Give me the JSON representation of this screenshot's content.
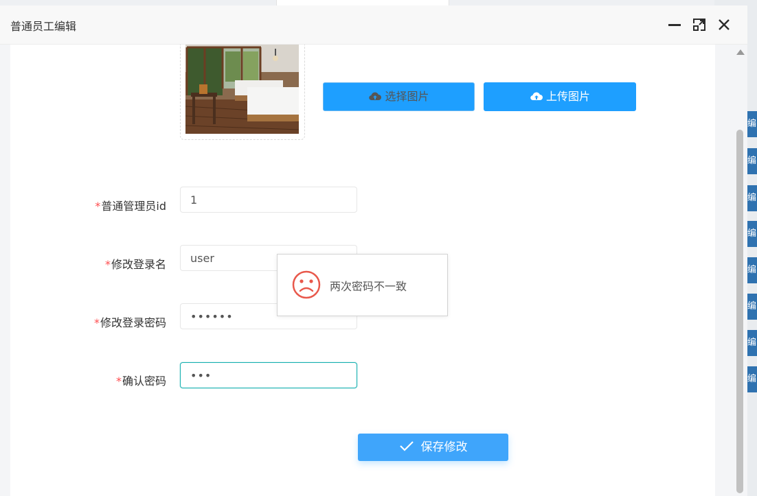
{
  "dialog": {
    "title": "普通员工编辑",
    "controls": {
      "minimize": "minimize-icon",
      "maximize": "maximize-icon",
      "close": "close-icon"
    }
  },
  "image": {
    "description_icon": "image-preview"
  },
  "buttons": {
    "select_image": "选择图片",
    "upload_image": "上传图片",
    "save": "保存修改"
  },
  "form": {
    "admin_id": {
      "label": "普通管理员id",
      "value": "1"
    },
    "login_name": {
      "label": "修改登录名",
      "value": "user"
    },
    "login_password": {
      "label": "修改登录密码",
      "value": "••••••"
    },
    "confirm_password": {
      "label": "确认密码",
      "value": "•••"
    }
  },
  "required_mark": "*",
  "toast": {
    "message": "两次密码不一致",
    "icon": "sad-face-icon"
  },
  "background_rows": [
    "编",
    "编",
    "编",
    "编",
    "编",
    "编",
    "编",
    "编"
  ],
  "colors": {
    "primary": "#1e9fff",
    "required": "#ff4d4f",
    "focus": "#16b0b0",
    "toast_icon": "#e8584b"
  }
}
